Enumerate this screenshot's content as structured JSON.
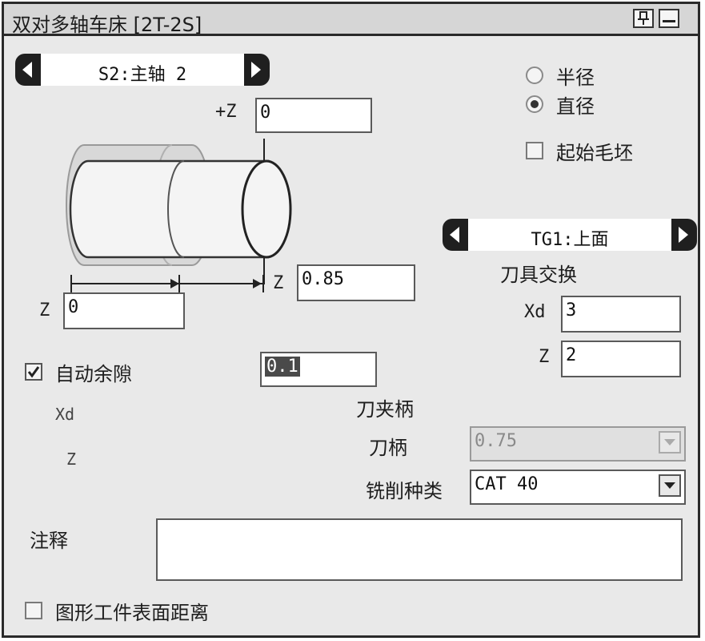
{
  "window": {
    "title": "双对多轴车床 [2T-2S]"
  },
  "spindle_nav": {
    "label": "S2:主轴 2"
  },
  "plus_z": {
    "label": "+Z",
    "value": "0"
  },
  "radius_option": {
    "label": "半径",
    "selected": false
  },
  "diameter_option": {
    "label": "直径",
    "selected": true
  },
  "initial_stock": {
    "label": "起始毛坯",
    "checked": false
  },
  "tool_group_nav": {
    "label": "TG1:上面"
  },
  "tool_change": {
    "label": "刀具交换"
  },
  "stock_z": {
    "label": "Z",
    "value": "0.85"
  },
  "left_z": {
    "label": "Z",
    "value": "0"
  },
  "tool_xd": {
    "label": "Xd",
    "value": "3"
  },
  "tool_z": {
    "label": "Z",
    "value": "2"
  },
  "auto_clearance": {
    "label": "自动余隙",
    "checked": true,
    "value": "0.1"
  },
  "clear_xd": {
    "label": "Xd"
  },
  "clear_z": {
    "label": "Z"
  },
  "holder": {
    "label": "刀夹柄"
  },
  "shank": {
    "label": "刀柄",
    "value": "0.75"
  },
  "milling_type": {
    "label": "铣削种类",
    "value": "CAT 40"
  },
  "notes": {
    "label": "注释",
    "value": ""
  },
  "graphic_distance": {
    "label": "图形工件表面距离",
    "checked": false
  },
  "icons": [
    "pin-icon",
    "minimize-icon",
    "arrow-left-icon",
    "arrow-right-icon",
    "dropdown-arrow-icon"
  ]
}
